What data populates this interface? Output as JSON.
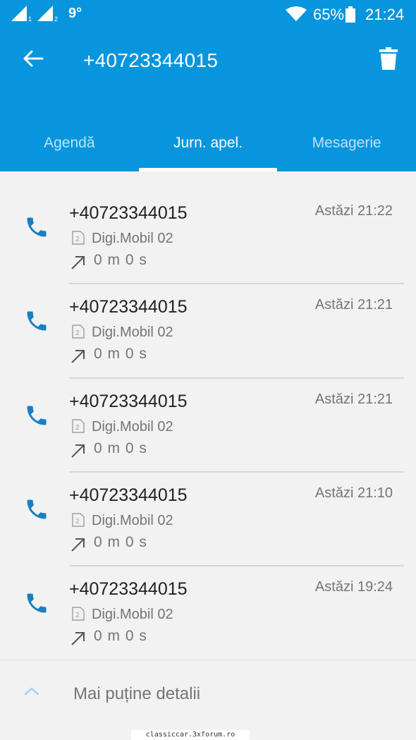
{
  "status_bar": {
    "temperature": "9°",
    "battery": "65%",
    "time": "21:24",
    "sim1_label": "1",
    "sim2_label": "2"
  },
  "header": {
    "title": "+40723344015",
    "back_icon": "arrow-left-icon",
    "delete_icon": "trash-icon"
  },
  "tabs": [
    {
      "label": "Agendă",
      "active": false
    },
    {
      "label": "Jurn. apel.",
      "active": true
    },
    {
      "label": "Mesagerie",
      "active": false
    }
  ],
  "calls": [
    {
      "number": "+40723344015",
      "time": "Astăzi 21:22",
      "sim_label": "2",
      "carrier": "Digi.Mobil 02",
      "duration": "0 m 0 s",
      "direction": "outgoing"
    },
    {
      "number": "+40723344015",
      "time": "Astăzi 21:21",
      "sim_label": "2",
      "carrier": "Digi.Mobil 02",
      "duration": "0 m 0 s",
      "direction": "outgoing"
    },
    {
      "number": "+40723344015",
      "time": "Astăzi 21:21",
      "sim_label": "2",
      "carrier": "Digi.Mobil 02",
      "duration": "0 m 0 s",
      "direction": "outgoing"
    },
    {
      "number": "+40723344015",
      "time": "Astăzi 21:10",
      "sim_label": "2",
      "carrier": "Digi.Mobil 02",
      "duration": "0 m 0 s",
      "direction": "outgoing"
    },
    {
      "number": "+40723344015",
      "time": "Astăzi 19:24",
      "sim_label": "2",
      "carrier": "Digi.Mobil 02",
      "duration": "0 m 0 s",
      "direction": "outgoing"
    }
  ],
  "footer": {
    "details_label": "Mai puține detalii"
  },
  "watermark": "classiccar.3xforum.ro",
  "colors": {
    "primary": "#0795dd",
    "icon": "#1a7fc1",
    "muted_text": "#757575"
  }
}
